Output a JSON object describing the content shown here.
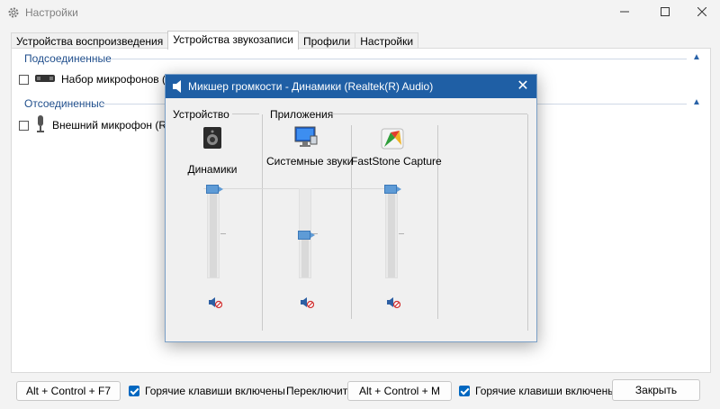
{
  "window": {
    "title": "Настройки",
    "icon": "gear-icon",
    "controls": [
      "minimize-icon",
      "maximize-icon",
      "close-icon"
    ]
  },
  "tabs": [
    {
      "label": "Устройства воспроизведения",
      "active": false
    },
    {
      "label": "Устройства звукозаписи",
      "active": true
    },
    {
      "label": "Профили",
      "active": false
    },
    {
      "label": "Настройки",
      "active": false
    }
  ],
  "groups": {
    "connected": {
      "label": "Подсоединенные",
      "device": "Набор микрофонов (Tech"
    },
    "disconnected": {
      "label": "Отсоединенные",
      "device": "Внешний микрофон (Rea"
    }
  },
  "bottom": {
    "hotkey1": "Alt + Control + F7",
    "hotkeys_enabled_1": "Горячие клавиши включены",
    "switch_label": "Переключить",
    "hotkey2": "Alt + Control + M",
    "hotkeys_enabled_2": "Горячие клавиши включены",
    "close_button": "Закрыть"
  },
  "mixer": {
    "title": "Микшер громкости - Динамики (Realtek(R) Audio)",
    "device_section": "Устройство",
    "apps_section": "Приложения",
    "channels": [
      {
        "label": "Динамики",
        "icon": "speaker-icon",
        "level": 1.0,
        "muted_icon": "muted-speaker-icon"
      },
      {
        "label": "Системные звуки",
        "icon": "system-sounds-icon",
        "level": 0.5,
        "muted_icon": "muted-speaker-icon"
      },
      {
        "label": "FastStone Capture",
        "icon": "faststone-icon",
        "level": 1.0,
        "muted_icon": "muted-speaker-icon"
      }
    ],
    "accent": "#1f5fa5"
  }
}
